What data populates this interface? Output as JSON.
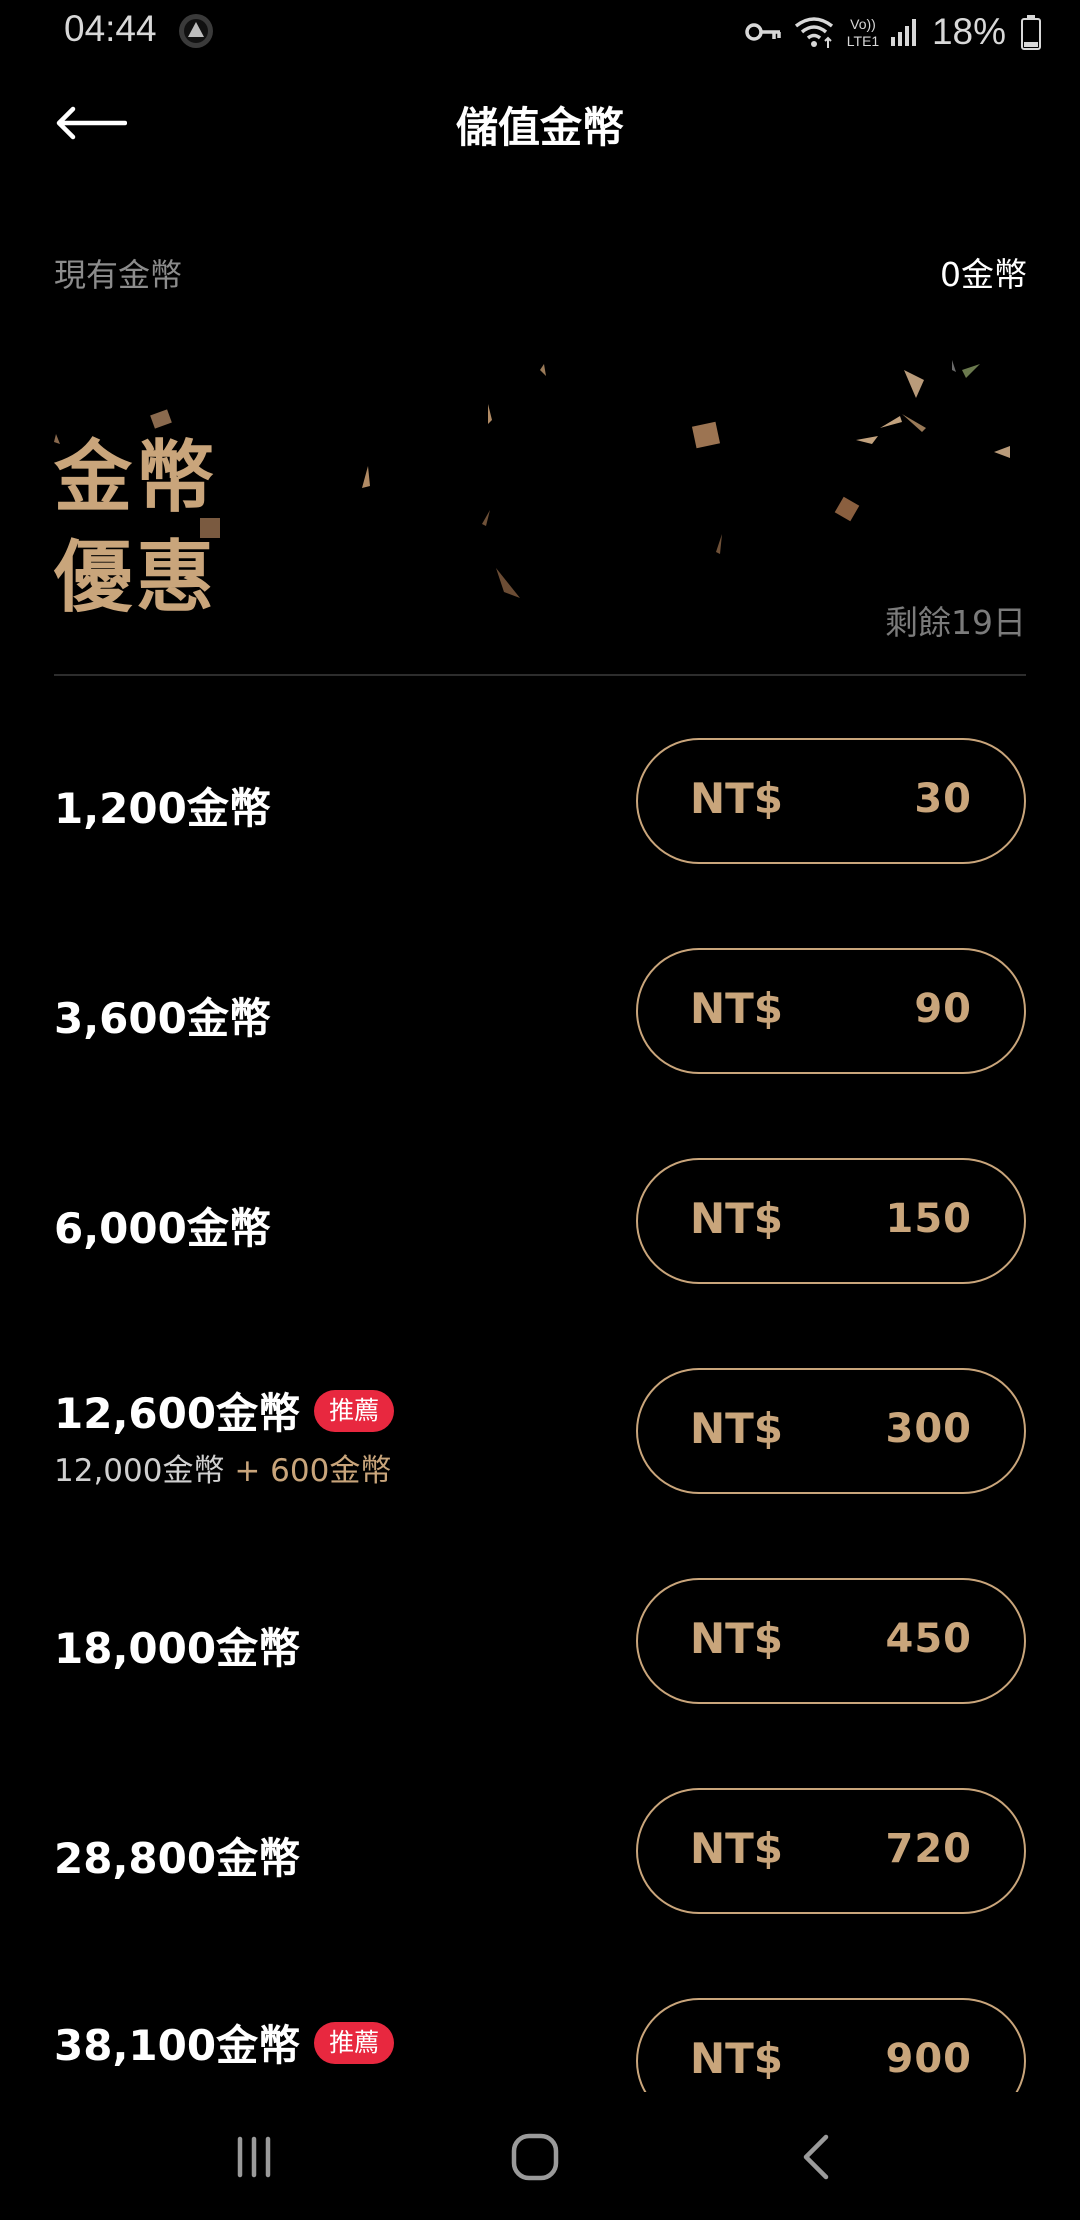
{
  "status_bar": {
    "time": "04:44",
    "battery_percent": "18%",
    "icons": [
      "app-notification-icon",
      "key-icon",
      "wifi-icon",
      "volte-icon",
      "signal-icon",
      "battery-icon"
    ],
    "volte_label_top": "Vo))",
    "volte_label_bottom": "LTE1"
  },
  "header": {
    "title": "儲值金幣",
    "back_icon": "arrow-left-icon"
  },
  "balance": {
    "label": "現有金幣",
    "value": "0金幣"
  },
  "promo": {
    "title_line1": "金幣",
    "title_line2": "優惠",
    "remaining": "剩餘19日"
  },
  "packages": [
    {
      "coins": "1,200金幣",
      "badge": "",
      "base": "",
      "bonus": "",
      "currency": "NT$",
      "price": "30"
    },
    {
      "coins": "3,600金幣",
      "badge": "",
      "base": "",
      "bonus": "",
      "currency": "NT$",
      "price": "90"
    },
    {
      "coins": "6,000金幣",
      "badge": "",
      "base": "",
      "bonus": "",
      "currency": "NT$",
      "price": "150"
    },
    {
      "coins": "12,600金幣",
      "badge": "推薦",
      "base": "12,000金幣",
      "bonus": " + 600金幣",
      "currency": "NT$",
      "price": "300"
    },
    {
      "coins": "18,000金幣",
      "badge": "",
      "base": "",
      "bonus": "",
      "currency": "NT$",
      "price": "450"
    },
    {
      "coins": "28,800金幣",
      "badge": "",
      "base": "",
      "bonus": "",
      "currency": "NT$",
      "price": "720"
    },
    {
      "coins": "38,100金幣",
      "badge": "推薦",
      "base": "",
      "bonus": "",
      "currency": "NT$",
      "price": "900"
    }
  ],
  "nav_bar": {
    "icons": [
      "recent-apps-icon",
      "home-icon",
      "back-icon"
    ]
  },
  "colors": {
    "background": "#000000",
    "gold": "#c9a57b",
    "badge_red": "#e8283f",
    "muted_text": "#8c8c8c"
  }
}
